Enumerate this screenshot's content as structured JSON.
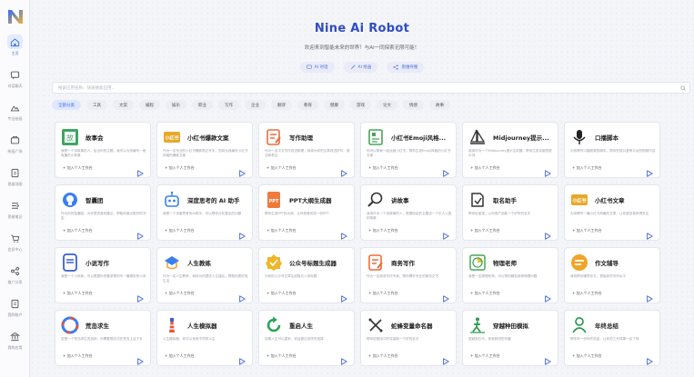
{
  "app": {
    "title": "Nine Ai Robot",
    "subtitle": "欢迎来到智能未来的世界！与AI一同探索无限可能！",
    "logo_letter": "N"
  },
  "sidebar": {
    "items": [
      {
        "label": "主页",
        "icon": "home-icon",
        "active": true
      },
      {
        "label": "对话聊天",
        "icon": "chat-icon"
      },
      {
        "label": "专业绘画",
        "icon": "paint-icon"
      },
      {
        "label": "绘画广场",
        "icon": "gallery-icon"
      },
      {
        "label": "思维导图",
        "icon": "mindmap-icon"
      },
      {
        "label": "思维笔记",
        "icon": "note-icon"
      },
      {
        "label": "会员中心",
        "icon": "cart-icon"
      },
      {
        "label": "推广分享",
        "icon": "share-icon"
      },
      {
        "label": "我的账户",
        "icon": "account-icon"
      },
      {
        "label": "我的应用",
        "icon": "bank-icon"
      }
    ]
  },
  "quick_actions": [
    {
      "label": "AI 对话",
      "icon": "chat-icon"
    },
    {
      "label": "AI 绘画",
      "icon": "magic-icon"
    },
    {
      "label": "思维导图",
      "icon": "mindmap-icon"
    }
  ],
  "search": {
    "placeholder": "搜索应用名称、快速搜索应用..."
  },
  "categories": [
    {
      "label": "全部分类",
      "active": true
    },
    {
      "label": "工具"
    },
    {
      "label": "文案"
    },
    {
      "label": "编程"
    },
    {
      "label": "娱乐"
    },
    {
      "label": "职业"
    },
    {
      "label": "写作"
    },
    {
      "label": "企业"
    },
    {
      "label": "翻译"
    },
    {
      "label": "教育"
    },
    {
      "label": "健康"
    },
    {
      "label": "游戏"
    },
    {
      "label": "论文"
    },
    {
      "label": "情感"
    },
    {
      "label": "故事"
    }
  ],
  "add_label": "加入个人工作台",
  "apps": [
    {
      "title": "故事会",
      "desc": "我是一个讲故事的人，给出你的主题，我可以为你编写一段有趣的小故事",
      "icon": "book-icon",
      "color": "#3fa564"
    },
    {
      "title": "小红书爆款文案",
      "desc": "作为一名专业的小红书爆款笔记写手，您将为我编写小红书风格的爆款文案",
      "icon": "xhs-icon",
      "color": "#e7a82a"
    },
    {
      "title": "写作助理",
      "desc": "作为一名中文写作改进助理，我将为你的文章改进拼写、语法和表达",
      "icon": "edit-icon",
      "color": "#f06a3a"
    },
    {
      "title": "小红书Emoji风格...",
      "desc": "你可以帮我一起运营小红书，帮你生成Emoji风格的小红书文案",
      "icon": "emoji-doc-icon",
      "color": "#48a55b"
    },
    {
      "title": "Midjourney提示...",
      "desc": "我将作为一个Midjourney提示生成器，帮你生成详细的提示词",
      "icon": "sailboat-icon",
      "color": "#333333"
    },
    {
      "title": "口播脚本",
      "desc": "为你撰写口播视频的脚本，帮你完成抖音等平台的视频内容",
      "icon": "microphone-icon",
      "color": "#222222"
    },
    {
      "title": "智囊团",
      "desc": "作为你的智囊团，为你提供各种建议，帮助你做出更好的决定",
      "icon": "bulb-icon",
      "color": "#3a7ff0"
    },
    {
      "title": "深度思考的 AI 助手",
      "desc": "我是一个深度思考的AI助手，可以帮你分析复杂的问题",
      "icon": "robot-icon",
      "color": "#3a7ff0"
    },
    {
      "title": "PPT大纲生成器",
      "desc": "帮你生成PPT的大纲，让你快速完成一份PPT",
      "icon": "ppt-icon",
      "color": "#f07a3a"
    },
    {
      "title": "讲故事",
      "desc": "我将作为一个讲故事的人，根据你给的主题讲一个引人入胜的故事",
      "icon": "search-doc-icon",
      "color": "#333333"
    },
    {
      "title": "取名助手",
      "desc": "帮你给宝宝、公司或产品取一个好听的名字",
      "icon": "name-tag-icon",
      "color": "#333333"
    },
    {
      "title": "小红书文章",
      "desc": "为你撰写一篇小红书风格的文章，让你更容易获得关注",
      "icon": "xhs-icon",
      "color": "#e7a82a"
    },
    {
      "title": "小说写作",
      "desc": "我是一个小说家，可以根据你的要求帮你写一篇精彩的小说",
      "icon": "notebook-icon",
      "color": "#3a5fd0"
    },
    {
      "title": "人生教练",
      "desc": "作为一名人生教练，我将为你提供人生建议，帮助你更好地生活",
      "icon": "coach-icon",
      "color": "#3a7ff0"
    },
    {
      "title": "公众号标题生成器",
      "desc": "为你的公众号文章生成吸引人的标题",
      "icon": "badge-icon",
      "color": "#f0b62a"
    },
    {
      "title": "商务写作",
      "desc": "作为一名商务写作专家，帮你撰写专业的商务文书",
      "icon": "edit-icon",
      "color": "#f06a3a"
    },
    {
      "title": "物理老师",
      "desc": "我是一名物理老师，可以帮你解答各种物理问题",
      "icon": "chart-pie-icon",
      "color": "#48a55b"
    },
    {
      "title": "作文辅导",
      "desc": "我将帮你辅导作文，提高你的写作水平",
      "icon": "minus-circle-icon",
      "color": "#f0a52a"
    },
    {
      "title": "荒岛求生",
      "desc": "这是一个荒岛求生的游戏，你需要想办法在荒岛上活下去",
      "icon": "lifebuoy-icon",
      "color": "#3a7ff0"
    },
    {
      "title": "人生模拟器",
      "desc": "人生模拟器，你可以体验不同的人生",
      "icon": "lighthouse-icon",
      "color": "#e05a3a"
    },
    {
      "title": "重启人生",
      "desc": "如果人生可以重来，你会做出怎样的选择",
      "icon": "refresh-icon",
      "color": "#2aa55a"
    },
    {
      "title": "蛇蜂变量命名器",
      "desc": "帮你给程序中的变量取一个好的名字",
      "icon": "close-x-icon",
      "color": "#333333"
    },
    {
      "title": "穿越种田模拟",
      "desc": "穿越到古代，体验种田的乐趣",
      "icon": "walker-icon",
      "color": "#2a9a4a"
    },
    {
      "title": "年终总结",
      "desc": "帮你写一份年终总结，让你的工作成果一目了然",
      "icon": "person-icon",
      "color": "#2a9a4a"
    }
  ]
}
